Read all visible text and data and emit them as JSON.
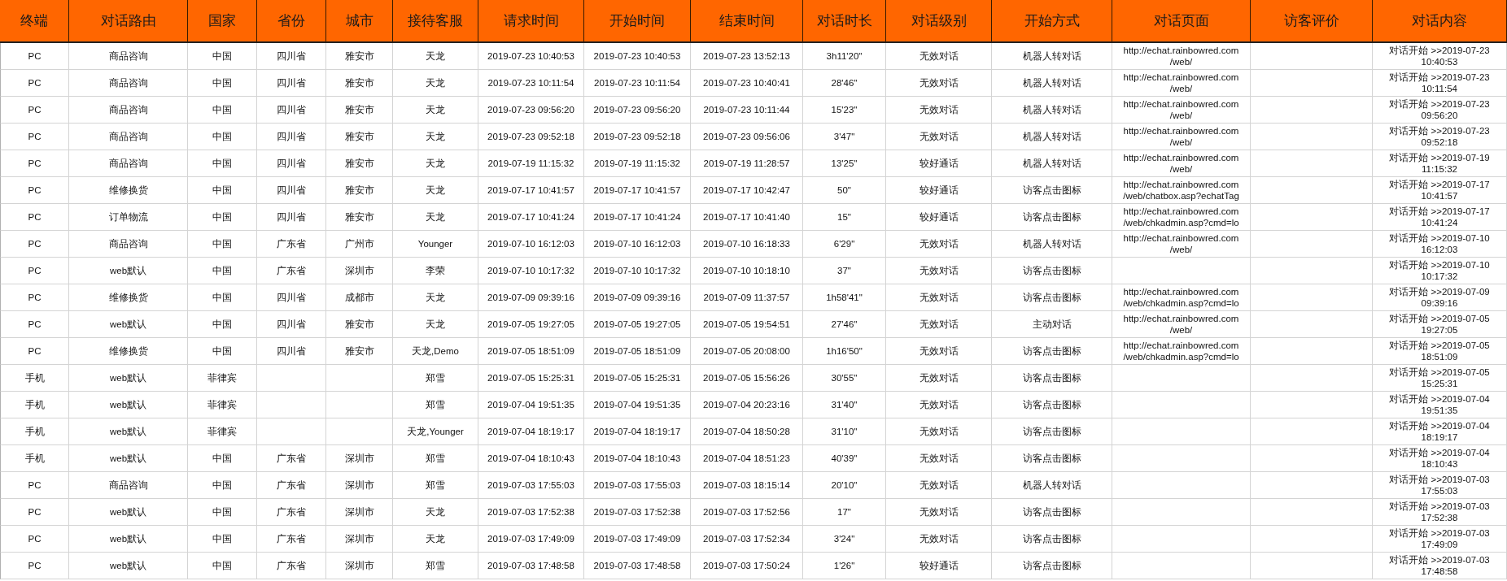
{
  "table": {
    "columns": [
      "终端",
      "对话路由",
      "国家",
      "省份",
      "城市",
      "接待客服",
      "请求时间",
      "开始时间",
      "结束时间",
      "对话时长",
      "对话级别",
      "开始方式",
      "对话页面",
      "访客评价",
      "对话内容"
    ],
    "rows": [
      {
        "terminal": "PC",
        "route": "商品咨询",
        "country": "中国",
        "province": "四川省",
        "city": "雅安市",
        "agent": "天龙",
        "request_time": "2019-07-23 10:40:53",
        "start_time": "2019-07-23 10:40:53",
        "end_time": "2019-07-23 13:52:13",
        "duration": "3h11'20\"",
        "level": "无效对话",
        "start_mode": "机器人转对话",
        "page": "http://echat.rainbowred.com\n/web/",
        "content": "对话开始 >>2019-07-23\n10:40:53"
      },
      {
        "terminal": "PC",
        "route": "商品咨询",
        "country": "中国",
        "province": "四川省",
        "city": "雅安市",
        "agent": "天龙",
        "request_time": "2019-07-23 10:11:54",
        "start_time": "2019-07-23 10:11:54",
        "end_time": "2019-07-23 10:40:41",
        "duration": "28'46\"",
        "level": "无效对话",
        "start_mode": "机器人转对话",
        "page": "http://echat.rainbowred.com\n/web/",
        "content": "对话开始 >>2019-07-23\n10:11:54"
      },
      {
        "terminal": "PC",
        "route": "商品咨询",
        "country": "中国",
        "province": "四川省",
        "city": "雅安市",
        "agent": "天龙",
        "request_time": "2019-07-23 09:56:20",
        "start_time": "2019-07-23 09:56:20",
        "end_time": "2019-07-23 10:11:44",
        "duration": "15'23\"",
        "level": "无效对话",
        "start_mode": "机器人转对话",
        "page": "http://echat.rainbowred.com\n/web/",
        "content": "对话开始 >>2019-07-23\n09:56:20"
      },
      {
        "terminal": "PC",
        "route": "商品咨询",
        "country": "中国",
        "province": "四川省",
        "city": "雅安市",
        "agent": "天龙",
        "request_time": "2019-07-23 09:52:18",
        "start_time": "2019-07-23 09:52:18",
        "end_time": "2019-07-23 09:56:06",
        "duration": "3'47\"",
        "level": "无效对话",
        "start_mode": "机器人转对话",
        "page": "http://echat.rainbowred.com\n/web/",
        "content": "对话开始 >>2019-07-23\n09:52:18"
      },
      {
        "terminal": "PC",
        "route": "商品咨询",
        "country": "中国",
        "province": "四川省",
        "city": "雅安市",
        "agent": "天龙",
        "request_time": "2019-07-19 11:15:32",
        "start_time": "2019-07-19 11:15:32",
        "end_time": "2019-07-19 11:28:57",
        "duration": "13'25\"",
        "level": "较好通话",
        "start_mode": "机器人转对话",
        "page": "http://echat.rainbowred.com\n/web/",
        "content": "对话开始 >>2019-07-19\n11:15:32"
      },
      {
        "terminal": "PC",
        "route": "维修换货",
        "country": "中国",
        "province": "四川省",
        "city": "雅安市",
        "agent": "天龙",
        "request_time": "2019-07-17 10:41:57",
        "start_time": "2019-07-17 10:41:57",
        "end_time": "2019-07-17 10:42:47",
        "duration": "50\"",
        "level": "较好通话",
        "start_mode": "访客点击图标",
        "page": "http://echat.rainbowred.com\n/web/chatbox.asp?echatTag",
        "content": "对话开始 >>2019-07-17\n10:41:57"
      },
      {
        "terminal": "PC",
        "route": "订单物流",
        "country": "中国",
        "province": "四川省",
        "city": "雅安市",
        "agent": "天龙",
        "request_time": "2019-07-17 10:41:24",
        "start_time": "2019-07-17 10:41:24",
        "end_time": "2019-07-17 10:41:40",
        "duration": "15\"",
        "level": "较好通话",
        "start_mode": "访客点击图标",
        "page": "http://echat.rainbowred.com\n/web/chkadmin.asp?cmd=lo",
        "content": "对话开始 >>2019-07-17\n10:41:24"
      },
      {
        "terminal": "PC",
        "route": "商品咨询",
        "country": "中国",
        "province": "广东省",
        "city": "广州市",
        "agent": "Younger",
        "request_time": "2019-07-10 16:12:03",
        "start_time": "2019-07-10 16:12:03",
        "end_time": "2019-07-10 16:18:33",
        "duration": "6'29\"",
        "level": "无效对话",
        "start_mode": "机器人转对话",
        "page": "http://echat.rainbowred.com\n/web/",
        "content": "对话开始 >>2019-07-10\n16:12:03"
      },
      {
        "terminal": "PC",
        "route": "web默认",
        "country": "中国",
        "province": "广东省",
        "city": "深圳市",
        "agent": "李荣",
        "request_time": "2019-07-10 10:17:32",
        "start_time": "2019-07-10 10:17:32",
        "end_time": "2019-07-10 10:18:10",
        "duration": "37\"",
        "level": "无效对话",
        "start_mode": "访客点击图标",
        "content": "对话开始 >>2019-07-10\n10:17:32"
      },
      {
        "terminal": "PC",
        "route": "维修换货",
        "country": "中国",
        "province": "四川省",
        "city": "成都市",
        "agent": "天龙",
        "request_time": "2019-07-09 09:39:16",
        "start_time": "2019-07-09 09:39:16",
        "end_time": "2019-07-09 11:37:57",
        "duration": "1h58'41\"",
        "level": "无效对话",
        "start_mode": "访客点击图标",
        "page": "http://echat.rainbowred.com\n/web/chkadmin.asp?cmd=lo",
        "content": "对话开始 >>2019-07-09\n09:39:16"
      },
      {
        "terminal": "PC",
        "route": "web默认",
        "country": "中国",
        "province": "四川省",
        "city": "雅安市",
        "agent": "天龙",
        "request_time": "2019-07-05 19:27:05",
        "start_time": "2019-07-05 19:27:05",
        "end_time": "2019-07-05 19:54:51",
        "duration": "27'46\"",
        "level": "无效对话",
        "start_mode": "主动对话",
        "page": "http://echat.rainbowred.com\n/web/",
        "content": "对话开始 >>2019-07-05\n19:27:05"
      },
      {
        "terminal": "PC",
        "route": "维修换货",
        "country": "中国",
        "province": "四川省",
        "city": "雅安市",
        "agent": "天龙,Demo",
        "request_time": "2019-07-05 18:51:09",
        "start_time": "2019-07-05 18:51:09",
        "end_time": "2019-07-05 20:08:00",
        "duration": "1h16'50\"",
        "level": "无效对话",
        "start_mode": "访客点击图标",
        "page": "http://echat.rainbowred.com\n/web/chkadmin.asp?cmd=lo",
        "content": "对话开始 >>2019-07-05\n18:51:09"
      },
      {
        "terminal": "手机",
        "route": "web默认",
        "country": "菲律宾",
        "agent": "郑雪",
        "request_time": "2019-07-05 15:25:31",
        "start_time": "2019-07-05 15:25:31",
        "end_time": "2019-07-05 15:56:26",
        "duration": "30'55\"",
        "level": "无效对话",
        "start_mode": "访客点击图标",
        "content": "对话开始 >>2019-07-05\n15:25:31"
      },
      {
        "terminal": "手机",
        "route": "web默认",
        "country": "菲律宾",
        "agent": "郑雪",
        "request_time": "2019-07-04 19:51:35",
        "start_time": "2019-07-04 19:51:35",
        "end_time": "2019-07-04 20:23:16",
        "duration": "31'40\"",
        "level": "无效对话",
        "start_mode": "访客点击图标",
        "content": "对话开始 >>2019-07-04\n19:51:35"
      },
      {
        "terminal": "手机",
        "route": "web默认",
        "country": "菲律宾",
        "agent": "天龙,Younger",
        "request_time": "2019-07-04 18:19:17",
        "start_time": "2019-07-04 18:19:17",
        "end_time": "2019-07-04 18:50:28",
        "duration": "31'10\"",
        "level": "无效对话",
        "start_mode": "访客点击图标",
        "content": "对话开始 >>2019-07-04\n18:19:17"
      },
      {
        "terminal": "手机",
        "route": "web默认",
        "country": "中国",
        "province": "广东省",
        "city": "深圳市",
        "agent": "郑雪",
        "request_time": "2019-07-04 18:10:43",
        "start_time": "2019-07-04 18:10:43",
        "end_time": "2019-07-04 18:51:23",
        "duration": "40'39\"",
        "level": "无效对话",
        "start_mode": "访客点击图标",
        "content": "对话开始 >>2019-07-04\n18:10:43"
      },
      {
        "terminal": "PC",
        "route": "商品咨询",
        "country": "中国",
        "province": "广东省",
        "city": "深圳市",
        "agent": "郑雪",
        "request_time": "2019-07-03 17:55:03",
        "start_time": "2019-07-03 17:55:03",
        "end_time": "2019-07-03 18:15:14",
        "duration": "20'10\"",
        "level": "无效对话",
        "start_mode": "机器人转对话",
        "content": "对话开始 >>2019-07-03\n17:55:03"
      },
      {
        "terminal": "PC",
        "route": "web默认",
        "country": "中国",
        "province": "广东省",
        "city": "深圳市",
        "agent": "天龙",
        "request_time": "2019-07-03 17:52:38",
        "start_time": "2019-07-03 17:52:38",
        "end_time": "2019-07-03 17:52:56",
        "duration": "17\"",
        "level": "无效对话",
        "start_mode": "访客点击图标",
        "content": "对话开始 >>2019-07-03\n17:52:38"
      },
      {
        "terminal": "PC",
        "route": "web默认",
        "country": "中国",
        "province": "广东省",
        "city": "深圳市",
        "agent": "天龙",
        "request_time": "2019-07-03 17:49:09",
        "start_time": "2019-07-03 17:49:09",
        "end_time": "2019-07-03 17:52:34",
        "duration": "3'24\"",
        "level": "无效对话",
        "start_mode": "访客点击图标",
        "content": "对话开始 >>2019-07-03\n17:49:09"
      },
      {
        "terminal": "PC",
        "route": "web默认",
        "country": "中国",
        "province": "广东省",
        "city": "深圳市",
        "agent": "郑雪",
        "request_time": "2019-07-03 17:48:58",
        "start_time": "2019-07-03 17:48:58",
        "end_time": "2019-07-03 17:50:24",
        "duration": "1'26\"",
        "level": "较好通话",
        "start_mode": "访客点击图标",
        "content": "对话开始 >>2019-07-03\n17:48:58"
      }
    ]
  }
}
